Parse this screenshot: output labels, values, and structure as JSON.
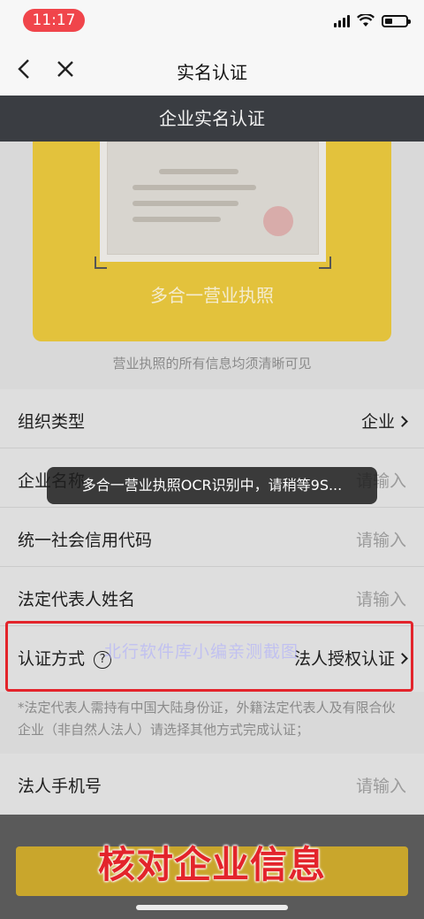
{
  "status_bar": {
    "time": "11:17"
  },
  "nav": {
    "title": "实名认证"
  },
  "sub_header": {
    "title": "企业实名认证"
  },
  "license": {
    "label": "多合一营业执照",
    "hint": "营业执照的所有信息均须清晰可见"
  },
  "form": {
    "rows": [
      {
        "label": "组织类型",
        "value": "企业"
      },
      {
        "label": "企业名称",
        "placeholder": "请输入"
      },
      {
        "label": "统一社会信用代码",
        "placeholder": "请输入"
      },
      {
        "label": "法定代表人姓名",
        "placeholder": "请输入"
      },
      {
        "label": "认证方式",
        "value": "法人授权认证",
        "help": "?"
      }
    ],
    "note": "*法定代表人需持有中国大陆身份证，外籍法定代表人及有限合伙企业（非自然人法人）请选择其他方式完成认证；",
    "phone": {
      "label": "法人手机号",
      "placeholder": "请输入"
    }
  },
  "toast": {
    "text": "多合一营业执照OCR识别中，请稍等9S..."
  },
  "watermark": {
    "text": "北行软件库小编亲测截图"
  },
  "overlay_caption": {
    "text": "核对企业信息"
  },
  "colors": {
    "accent_yellow": "#e3c23c",
    "highlight_red": "#e3242b",
    "header_dark": "#3a3d42"
  }
}
